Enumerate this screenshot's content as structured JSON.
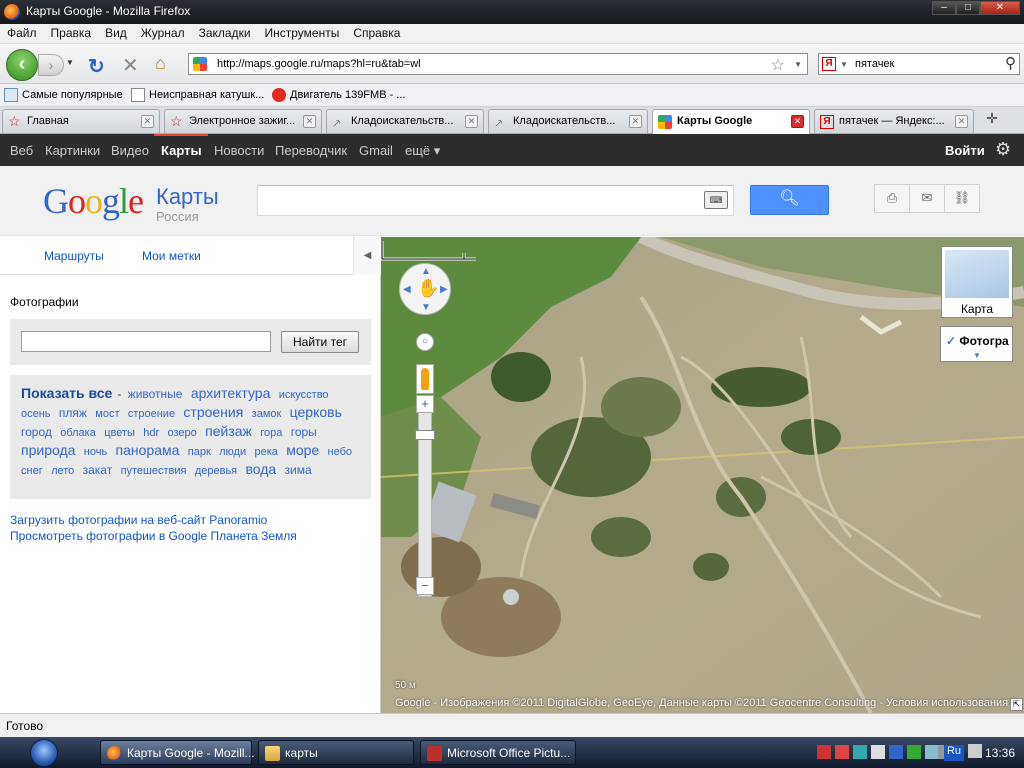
{
  "window": {
    "title": "Карты Google - Mozilla Firefox"
  },
  "menu": [
    "Файл",
    "Правка",
    "Вид",
    "Журнал",
    "Закладки",
    "Инструменты",
    "Справка"
  ],
  "nav": {
    "url": "http://maps.google.ru/maps?hl=ru&tab=wl",
    "search_engine": "Я",
    "search_value": "пятачек"
  },
  "bookmarks": [
    {
      "label": "Самые популярные",
      "icon": "page-icon"
    },
    {
      "label": "Неисправная катушк...",
      "icon": "page-icon"
    },
    {
      "label": "Двигатель 139FMB - ...",
      "icon": "opera-icon"
    }
  ],
  "tabs": [
    {
      "label": "Главная",
      "icon": "star-icon",
      "active": false
    },
    {
      "label": "Электронное зажиг...",
      "icon": "star-icon",
      "active": false
    },
    {
      "label": "Кладоискательств...",
      "icon": "shovel-icon",
      "active": false
    },
    {
      "label": "Кладоискательств...",
      "icon": "shovel-icon",
      "active": false
    },
    {
      "label": "Карты Google",
      "icon": "maps-icon",
      "active": true
    },
    {
      "label": "пятачек — Яндекс:...",
      "icon": "yandex-icon",
      "active": false
    }
  ],
  "google_bar": {
    "items": [
      "Веб",
      "Картинки",
      "Видео",
      "Карты",
      "Новости",
      "Переводчик",
      "Gmail",
      "ещё ▾"
    ],
    "selected": "Карты",
    "login": "Войти"
  },
  "header": {
    "logo_text": "Google",
    "product": "Карты",
    "subtitle": "Россия",
    "search_placeholder": ""
  },
  "left": {
    "tabs": [
      "Маршруты",
      "Мои метки"
    ],
    "photos_title": "Фотографии",
    "tag_button": "Найти тег",
    "show_all": "Показать все",
    "tags": [
      {
        "t": "животные",
        "s": 12
      },
      {
        "t": "архитектура",
        "s": 14
      },
      {
        "t": "искусство",
        "s": 11
      },
      {
        "t": "осень",
        "s": 11
      },
      {
        "t": "пляж",
        "s": 12
      },
      {
        "t": "мост",
        "s": 11
      },
      {
        "t": "строение",
        "s": 11
      },
      {
        "t": "строения",
        "s": 14
      },
      {
        "t": "замок",
        "s": 11
      },
      {
        "t": "церковь",
        "s": 14
      },
      {
        "t": "город",
        "s": 12
      },
      {
        "t": "облака",
        "s": 11
      },
      {
        "t": "цветы",
        "s": 11
      },
      {
        "t": "hdr",
        "s": 11
      },
      {
        "t": "озеро",
        "s": 11
      },
      {
        "t": "пейзаж",
        "s": 14
      },
      {
        "t": "гора",
        "s": 11
      },
      {
        "t": "горы",
        "s": 12
      },
      {
        "t": "природа",
        "s": 14
      },
      {
        "t": "ночь",
        "s": 11
      },
      {
        "t": "панорама",
        "s": 14
      },
      {
        "t": "парк",
        "s": 11
      },
      {
        "t": "люди",
        "s": 11
      },
      {
        "t": "река",
        "s": 11
      },
      {
        "t": "море",
        "s": 14
      },
      {
        "t": "небо",
        "s": 11
      },
      {
        "t": "снег",
        "s": 11
      },
      {
        "t": "лето",
        "s": 11
      },
      {
        "t": "закат",
        "s": 12
      },
      {
        "t": "путешествия",
        "s": 11
      },
      {
        "t": "деревья",
        "s": 11
      },
      {
        "t": "вода",
        "s": 14
      },
      {
        "t": "зима",
        "s": 12
      }
    ],
    "links": [
      "Загрузить фотографии на веб-сайт Panoramio",
      "Просмотреть фотографии в Google Планета Земля"
    ]
  },
  "map": {
    "maptype_label": "Карта",
    "photo_label": "Фотогра",
    "scale_label": "50 м",
    "copyright": "Google - Изображения ©2011 DigitalGlobe, GeoEye, Данные карты ©2011 Geocentre Consulting - Условия использования"
  },
  "status": "Готово",
  "taskbar": {
    "items": [
      {
        "label": "Карты Google - Mozill...",
        "icon": "firefox-icon",
        "active": true
      },
      {
        "label": "карты",
        "icon": "folder-icon",
        "active": false
      },
      {
        "label": "Microsoft Office Pictu...",
        "icon": "office-icon",
        "active": false
      }
    ],
    "lang": "Ru",
    "clock": "13:36"
  }
}
